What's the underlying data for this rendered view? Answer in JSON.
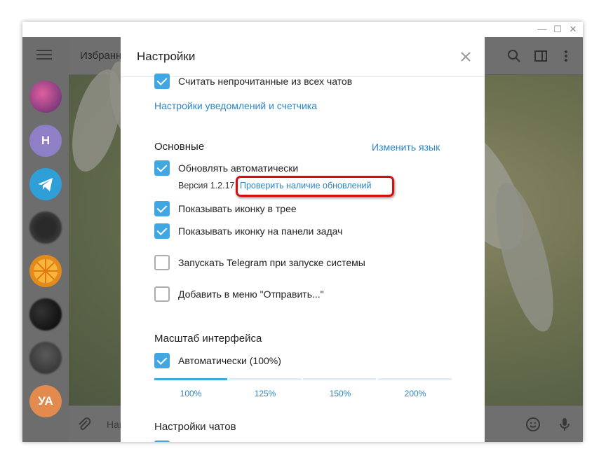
{
  "window": {
    "controls": {
      "minimize": "—",
      "maximize": "☐",
      "close": "✕"
    }
  },
  "chat": {
    "title": "Избранн",
    "input_placeholder": "Нап"
  },
  "sidebar": {
    "avatars": [
      {
        "initials": "",
        "color": "#9a3d7a"
      },
      {
        "initials": "Н",
        "color": "#8f7fc7"
      },
      {
        "initials": "",
        "color": "#2f9fd8"
      },
      {
        "initials": "",
        "color": "#1f1f1f"
      },
      {
        "initials": "",
        "color": "#e38a1c"
      },
      {
        "initials": "",
        "color": "#151515"
      },
      {
        "initials": "",
        "color": "#3a3a3a"
      },
      {
        "initials": "УА",
        "color": "#e38a4e"
      }
    ]
  },
  "settings": {
    "title": "Настройки",
    "count_unread": "Считать непрочитанные из всех чатов",
    "notifications_link": "Настройки уведомлений и счетчика",
    "general_title": "Основные",
    "change_language": "Изменить язык",
    "auto_update": "Обновлять автоматически",
    "version": "Версия 1.2.17",
    "check_updates": "Проверить наличие обновлений",
    "tray_icon": "Показывать иконку в трее",
    "taskbar_icon": "Показывать иконку на панели задач",
    "autostart": "Запускать Telegram при запуске системы",
    "send_to_menu": "Добавить в меню \"Отправить...\"",
    "scale_title": "Масштаб интерфейса",
    "auto_scale": "Автоматически (100%)",
    "scale_options": [
      "100%",
      "125%",
      "150%",
      "200%"
    ],
    "selected_scale": "100%",
    "chat_settings_title": "Настройки чатов",
    "checked": {
      "count_unread": true,
      "auto_update": true,
      "tray_icon": true,
      "taskbar_icon": true,
      "autostart": false,
      "send_to_menu": false,
      "auto_scale": true
    }
  },
  "colors": {
    "accent": "#40a7e3",
    "link": "#2c86c7",
    "highlight": "#d70e0e"
  }
}
